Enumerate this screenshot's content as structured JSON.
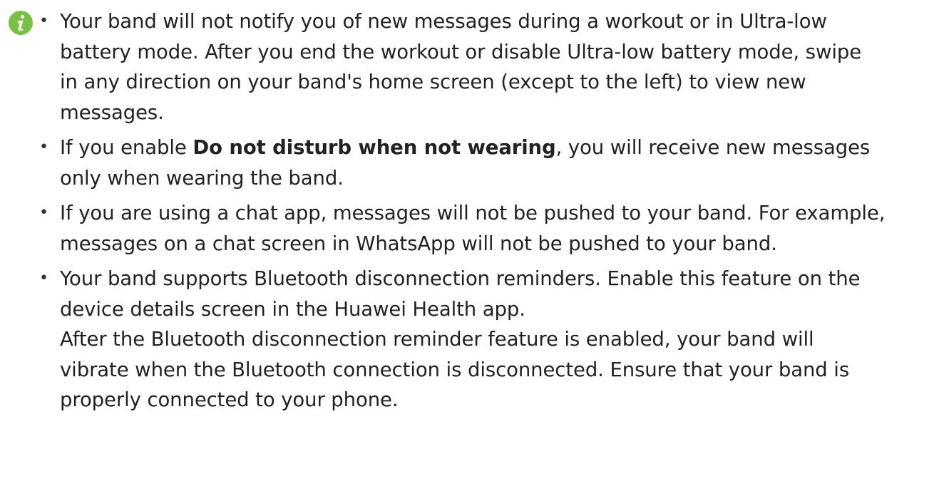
{
  "icon": {
    "name": "info-icon",
    "color": "#7ac143",
    "glyph": "i"
  },
  "bullets": [
    {
      "lines": [
        "Your band will not notify you of new messages during a workout or in Ultra-low",
        "battery mode. After you end the workout or disable Ultra-low battery mode, swipe",
        "in any direction on your band's home screen (except to the left) to view new",
        "messages."
      ]
    },
    {
      "prefix": "If you enable ",
      "bold": "Do not disturb when not wearing",
      "suffix": ", you will receive new messages",
      "line2": "only when wearing the band."
    },
    {
      "lines": [
        "If you are using a chat app, messages will not be pushed to your band. For example,",
        "messages on a chat screen in WhatsApp will not be pushed to your band."
      ]
    },
    {
      "lines": [
        "Your band supports Bluetooth disconnection reminders. Enable this feature on the",
        "device details screen in the Huawei Health app.",
        "After the Bluetooth disconnection reminder feature is enabled, your band will",
        "vibrate when the Bluetooth connection is disconnected. Ensure that your band is",
        "properly connected to your phone."
      ]
    }
  ]
}
